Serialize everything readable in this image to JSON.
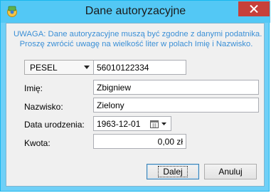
{
  "window": {
    "title": "Dane autoryzacyjne"
  },
  "warning": {
    "line1": "UWAGA: Dane autoryzacyjne muszą być zgodne z danymi podatnika.",
    "line2": "Proszę zwrócić uwagę na wielkość liter w polach Imię i Nazwisko."
  },
  "id_type": {
    "selected": "PESEL"
  },
  "id_number": {
    "value": "56010122334"
  },
  "first_name": {
    "label": "Imię:",
    "value": "Zbigniew"
  },
  "last_name": {
    "label": "Nazwisko:",
    "value": "Zielony"
  },
  "birth_date": {
    "label": "Data urodzenia:",
    "value": "1963-12-01"
  },
  "amount": {
    "label": "Kwota:",
    "value": "0,00 zł"
  },
  "buttons": {
    "next": "Dalej",
    "cancel": "Anuluj"
  },
  "colors": {
    "warning_text": "#3a8fd6",
    "title_bar": "#53c8f5",
    "close_button": "#c7403a"
  }
}
